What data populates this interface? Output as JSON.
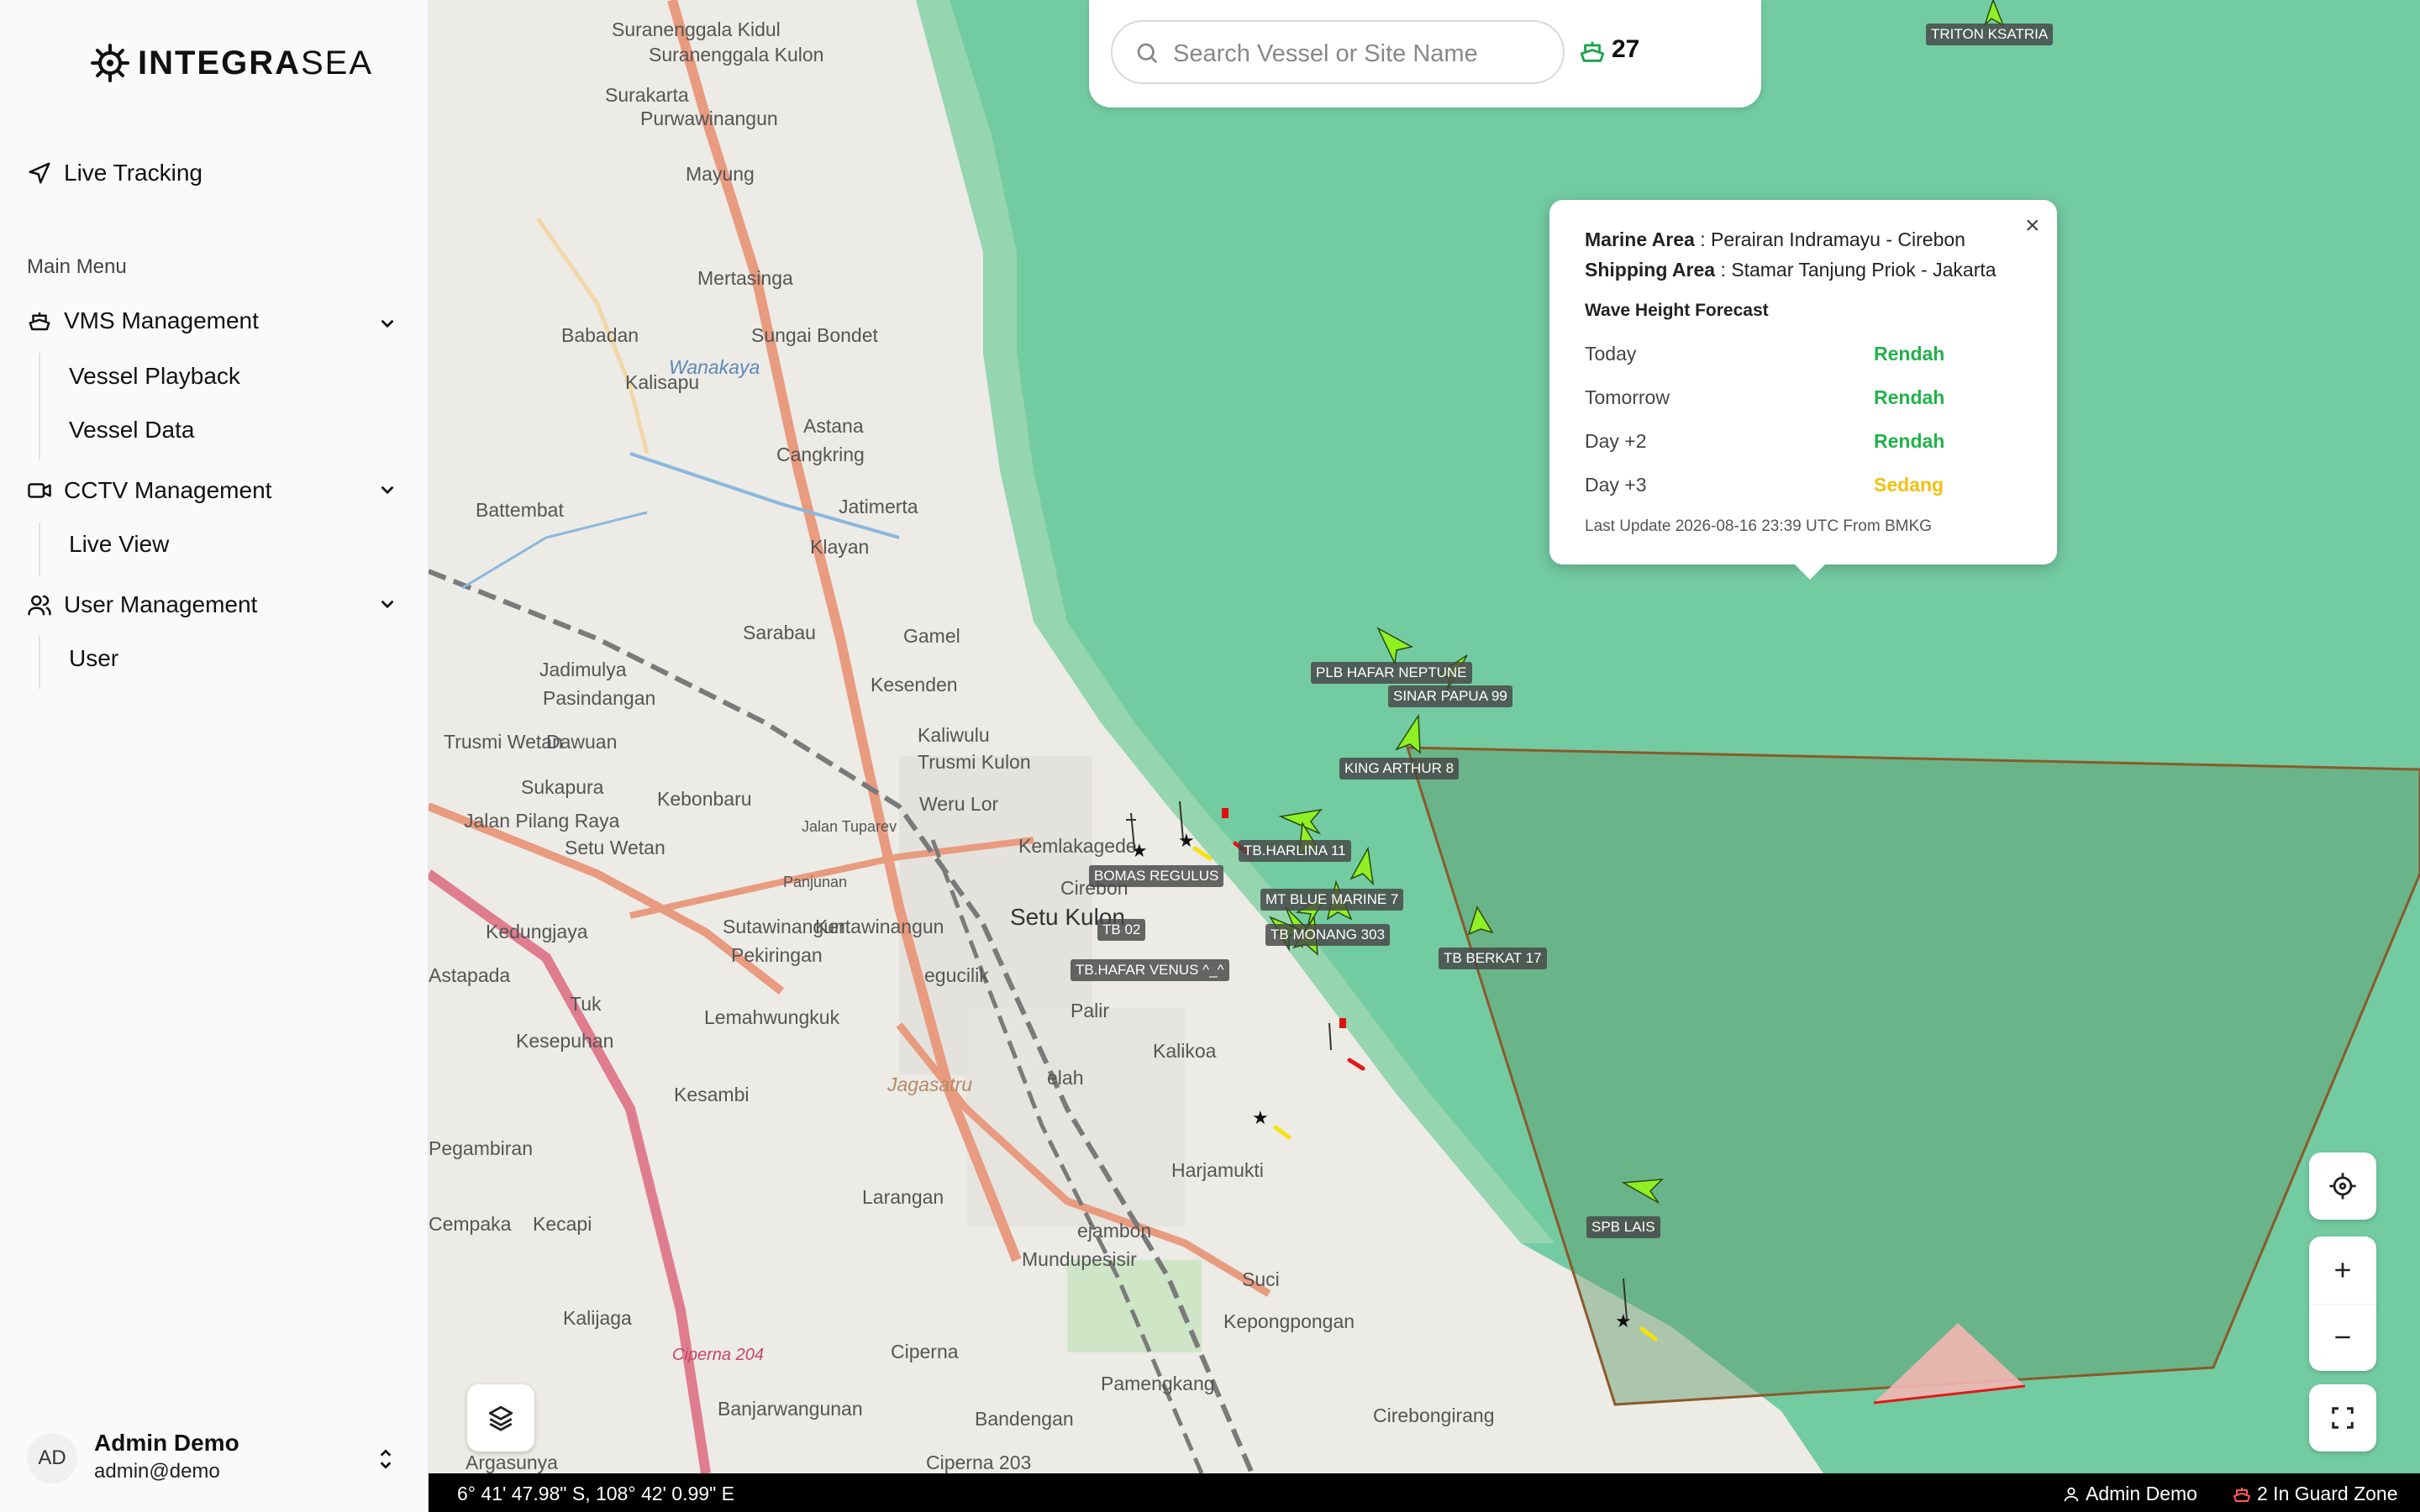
{
  "app": {
    "logo_text_a": "INTEGRA",
    "logo_text_b": "SEA"
  },
  "sidebar": {
    "live_tracking": "Live Tracking",
    "main_menu": "Main Menu",
    "groups": [
      {
        "label": "VMS Management",
        "icon": "ship-icon",
        "items": [
          "Vessel Playback",
          "Vessel Data"
        ]
      },
      {
        "label": "CCTV Management",
        "icon": "video-icon",
        "items": [
          "Live View"
        ]
      },
      {
        "label": "User Management",
        "icon": "users-icon",
        "items": [
          "User"
        ]
      }
    ]
  },
  "user": {
    "initials": "AD",
    "name": "Admin Demo",
    "email": "admin@demo"
  },
  "search": {
    "placeholder": "Search Vessel or Site Name",
    "vessel_count": "27"
  },
  "popup": {
    "marine_area_label": "Marine Area",
    "marine_area_value": "Perairan Indramayu - Cirebon",
    "shipping_area_label": "Shipping Area",
    "shipping_area_value": "Stamar Tanjung Priok - Jakarta",
    "forecast_title": "Wave Height Forecast",
    "rows": [
      {
        "day": "Today",
        "level": "Rendah",
        "color": "#22b24c"
      },
      {
        "day": "Tomorrow",
        "level": "Rendah",
        "color": "#22b24c"
      },
      {
        "day": "Day +2",
        "level": "Rendah",
        "color": "#22b24c"
      },
      {
        "day": "Day +3",
        "level": "Sedang",
        "color": "#f2c00f"
      }
    ],
    "last_update": "Last Update 2026-08-16 23:39 UTC From BMKG"
  },
  "map": {
    "places": [
      "Suranenggala Kidul",
      "Suranenggala Kulon",
      "Surakarta",
      "Purwawinangun",
      "Mayung",
      "Mertasinga",
      "Babadan",
      "Sungai Bondet",
      "Kalisapu",
      "Wanakaya",
      "Astana",
      "Cangkring",
      "Jatimerta",
      "Battembat",
      "Klayan",
      "Sarabau",
      "Gamel",
      "Jadimulya",
      "Pasindangan",
      "Kesenden",
      "Kaliwulu",
      "Trusmi Kulon",
      "Trusmi Wetan",
      "Dawuan",
      "Sukapura",
      "Kebonbaru",
      "Weru Lor",
      "Kemlakagede",
      "Jalan Pilang Raya",
      "Setu Wetan",
      "Jalan Tuparev",
      "Panjunan",
      "Cirebon",
      "Setu Kulon",
      "Kedungjaya",
      "Sutawinangun",
      "Kertawinangun",
      "Pekiringan",
      "egucilik",
      "Astapada",
      "Tuk",
      "Lemahwungkuk",
      "Palir",
      "Kesepuhan",
      "Kalikoa",
      "Kesambi",
      "Jagasatru",
      "elah",
      "Pegambiran",
      "Harjamukti",
      "Larangan",
      "ejambon",
      "Cempaka",
      "Kecapi",
      "Mundupesisir",
      "Suci",
      "Kepongpongan",
      "Kalijaga",
      "Ciperna",
      "Banjarwangunan",
      "Pamengkang",
      "Bandengan",
      "Cirebongirang",
      "Argasunya",
      "Ciperna 203",
      "Ciperna 204"
    ],
    "vessels": [
      "TRITON KSATRIA",
      "PLB HAFAR NEPTUNE",
      "SINAR PAPUA 99",
      "KING ARTHUR 8",
      "TB.HARLINA 11",
      "BOMAS REGULUS",
      "MT BLUE MARINE 7",
      "TB MONANG 303",
      "TB BERKAT 17",
      "TB 02",
      "TB.HAFAR VENUS ^_^",
      "SPB LAIS"
    ]
  },
  "status_bar": {
    "coords": "6° 41' 47.98\" S, 108° 42' 0.99\" E",
    "user": "Admin Demo",
    "guard_zone": "2 In Guard Zone"
  }
}
